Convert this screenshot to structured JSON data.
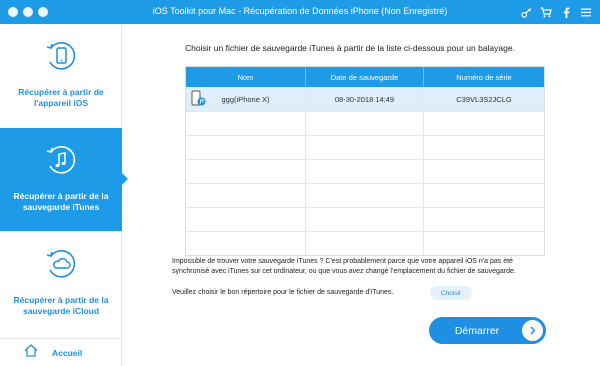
{
  "window": {
    "title": "iOS Toolkit pour Mac - Récupération de Données iPhone (Non Enregistré)"
  },
  "colors": {
    "accent": "#1e9be6",
    "sidebar_text": "#1f8fe0",
    "selected_row": "#dfeefb"
  },
  "sidebar": {
    "items": [
      {
        "label": "Récupérer à partir de l'appareil iOS",
        "icon": "device-restore-icon",
        "active": false
      },
      {
        "label": "Récupérer à partir de la sauvegarde iTunes",
        "icon": "itunes-restore-icon",
        "active": true
      },
      {
        "label": "Récupérer à partir de la sauvegarde iCloud",
        "icon": "icloud-restore-icon",
        "active": false
      }
    ],
    "home_label": "Accueil"
  },
  "main": {
    "instruction": "Choisir un fichier de sauvegarde iTunes à partir de la liste ci-dessous pour un balayage.",
    "table": {
      "columns": [
        "Nom",
        "Date de sauvegarde",
        "Numéro de série"
      ],
      "rows": [
        {
          "name": "ggg(iPhone X)",
          "date": "08-30-2018 14:49",
          "serial": "C39VL3S2JCLG"
        }
      ]
    },
    "info_text": "Impossible de trouver votre sauvegarde iTunes ? C'est probablement parce que votre appareil iOS n'a pas été synchronisé avec iTunes sur cet ordinateur, ou que vous avez changé l'emplacement du fichier de sauvegarde.",
    "choose_prompt": "Veuillez choisir le bon répertoire pour le fichier de sauvegarde d'iTunes.",
    "choose_button": "Choisir",
    "start_button": "Démarrer"
  }
}
